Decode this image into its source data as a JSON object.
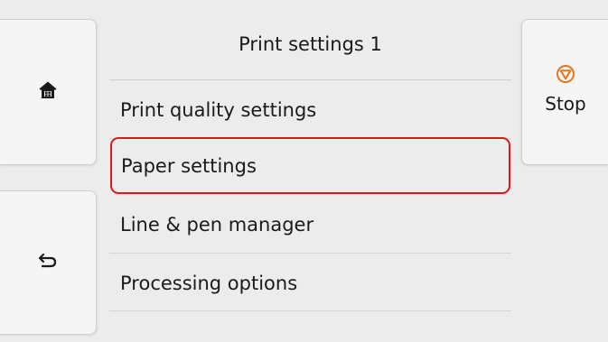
{
  "header": {
    "title": "Print settings 1"
  },
  "menu": {
    "items": [
      {
        "label": "Print quality settings"
      },
      {
        "label": "Paper settings"
      },
      {
        "label": "Line & pen manager"
      },
      {
        "label": "Processing options"
      }
    ],
    "selected_label": "Paper settings"
  },
  "left_nav": {
    "home_icon": "home-icon",
    "back_icon": "back-icon"
  },
  "stop": {
    "label": "Stop",
    "icon": "stop-icon",
    "accent_color": "#e87722"
  },
  "colors": {
    "selection_border": "#e2141d",
    "background": "#ececec",
    "button_face": "#f5f5f5"
  }
}
